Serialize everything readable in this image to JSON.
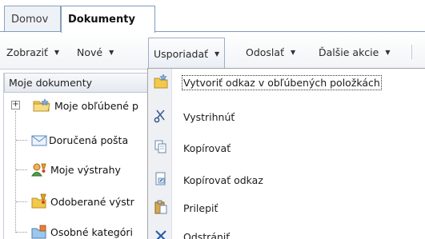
{
  "tabs": [
    {
      "label": "Domov"
    },
    {
      "label": "Dokumenty"
    }
  ],
  "toolbar": {
    "view_label": "Zobraziť",
    "new_label": "Nové",
    "organize_label": "Usporiadať",
    "send_label": "Odoslať",
    "more_label": "Ďalšie akcie"
  },
  "pane": {
    "header": "Moje dokumenty",
    "items": [
      {
        "label": "Moje obľúbené p",
        "icon": "folder-star-icon"
      },
      {
        "label": "Doručená pošta",
        "icon": "envelope-icon"
      },
      {
        "label": "Moje výstrahy",
        "icon": "alert-person-icon"
      },
      {
        "label": "Odoberané výstr",
        "icon": "alert-folder-icon"
      },
      {
        "label": "Osobné kategóri",
        "icon": "categories-icon"
      }
    ]
  },
  "menu": {
    "items": [
      {
        "label": "Vytvoriť odkaz v obľúbených položkách",
        "icon": "favorite-link-icon"
      },
      {
        "label": "Vystrihnúť",
        "icon": "scissors-icon"
      },
      {
        "label": "Kopírovať",
        "icon": "copy-icon"
      },
      {
        "label": "Kopírovať odkaz",
        "icon": "copy-link-icon"
      },
      {
        "label": "Prilepiť",
        "icon": "paste-icon"
      },
      {
        "label": "Odstrániť",
        "icon": "delete-icon"
      }
    ]
  },
  "colors": {
    "accent_border": "#7f9db9",
    "menu_gutter": "#eef0f4",
    "folder_yellow": "#f2c94c",
    "delete_blue": "#2b5ea8"
  }
}
